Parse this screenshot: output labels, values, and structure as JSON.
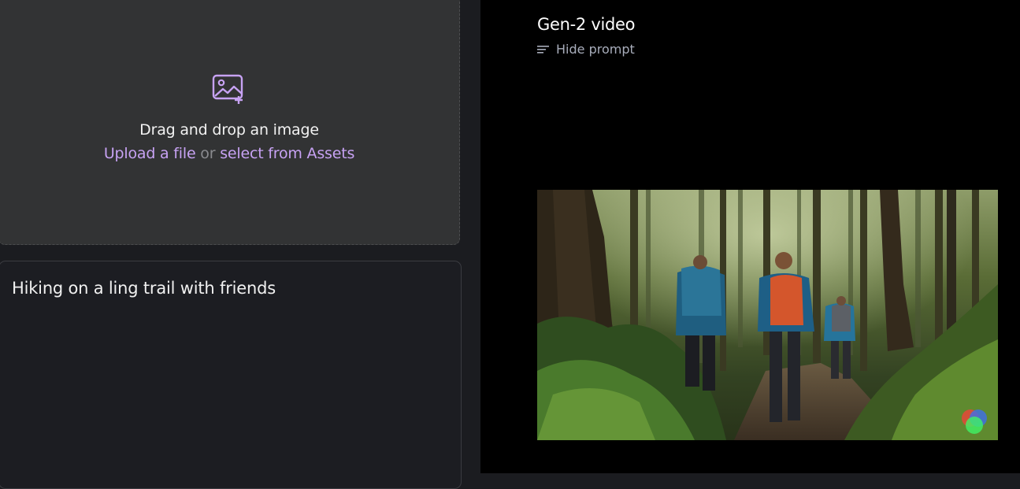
{
  "upload": {
    "title": "Drag and drop an image",
    "upload_link": "Upload a file",
    "or_text": "or",
    "assets_link": "select from Assets",
    "icon": "image-add-icon"
  },
  "prompt": {
    "text": "Hiking on a ling trail with friends"
  },
  "result": {
    "title": "Gen-2 video",
    "hide_prompt_label": "Hide prompt",
    "hide_prompt_icon": "lines-icon"
  },
  "colors": {
    "accent_link": "#c7a2f3",
    "panel_dark": "#1b1c20",
    "dropzone": "#323334",
    "result_bg": "#000000"
  }
}
